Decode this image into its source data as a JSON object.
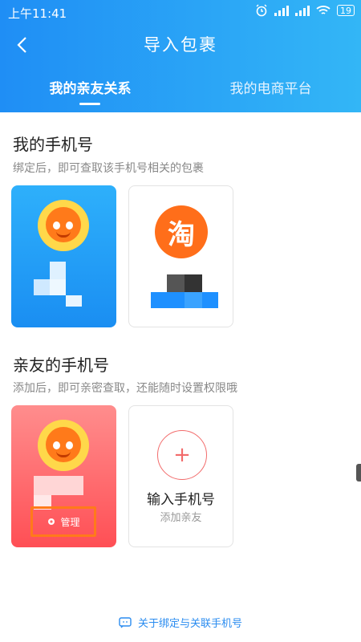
{
  "status_bar": {
    "time": "上午11:41",
    "battery": "19",
    "icons": [
      "alarm-icon",
      "signal-icon",
      "signal-icon",
      "wifi-icon",
      "battery-icon"
    ]
  },
  "header": {
    "title": "导入包裹",
    "back_icon": "chevron-left-icon"
  },
  "tabs": [
    {
      "label": "我的亲友关系",
      "active": true
    },
    {
      "label": "我的电商平台",
      "active": false
    }
  ],
  "my_phone": {
    "title": "我的手机号",
    "desc": "绑定后，即可查取该手机号相关的包裹",
    "cards": [
      {
        "type": "user",
        "icon": "mascot-avatar"
      },
      {
        "type": "platform",
        "logo_text": "淘",
        "icon": "taobao-logo"
      }
    ]
  },
  "friend_phone": {
    "title": "亲友的手机号",
    "desc": "添加后，即可亲密查取，还能随时设置权限哦",
    "card": {
      "manage_label": "管理",
      "icon": "gear-icon"
    },
    "add_card": {
      "plus": "+",
      "title": "输入手机号",
      "subtitle": "添加亲友"
    }
  },
  "footer": {
    "link": "关于绑定与关联手机号",
    "icon": "chat-icon"
  },
  "colors": {
    "header_start": "#1f8ef5",
    "header_end": "#33b6f6",
    "accent_red": "#f26b6b",
    "link_blue": "#2a8cf0",
    "highlight_orange": "#ff7a1a"
  }
}
